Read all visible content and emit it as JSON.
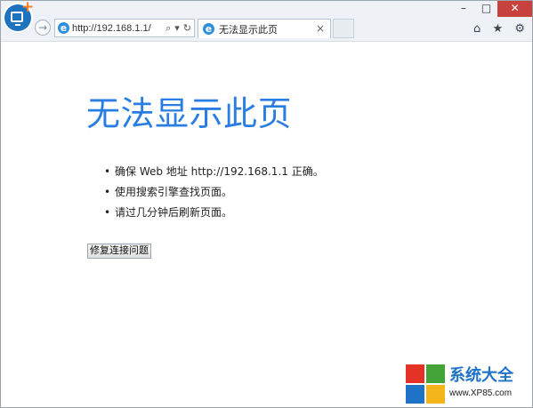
{
  "browser": {
    "address_bar": {
      "url": "http://192.168.1.1/",
      "search_icon": "search-icon",
      "dropdown_icon": "chevron-down-icon",
      "refresh_icon": "refresh-icon"
    },
    "tab": {
      "title": "无法显示此页",
      "close_icon": "close-icon"
    },
    "window_controls": {
      "minimize": "–",
      "maximize": "□",
      "close": "✕"
    },
    "toolbar": {
      "home_icon": "home-icon",
      "favorites_icon": "star-icon",
      "tools_icon": "gear-icon"
    }
  },
  "error_page": {
    "title": "无法显示此页",
    "bullets": [
      "确保 Web 地址 http://192.168.1.1 正确。",
      "使用搜索引擎查找页面。",
      "请过几分钟后刷新页面。"
    ],
    "fix_button_label": "修复连接问题"
  },
  "watermark": {
    "title": "系统大全",
    "url": "www.XP85.com",
    "colors": {
      "red": "#e33226",
      "green": "#44a338",
      "blue": "#1f73c7",
      "yellow": "#f3b51b"
    }
  },
  "colors": {
    "title_blue": "#2a7ee1",
    "close_red": "#c7413d",
    "app_badge_blue": "#1e73be",
    "app_badge_plus_orange": "#f58220"
  }
}
